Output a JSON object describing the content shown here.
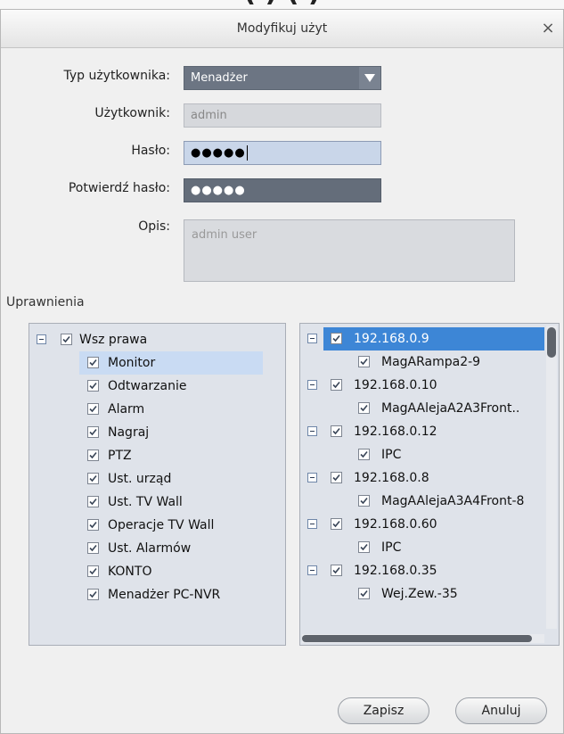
{
  "dialog": {
    "title": "Modyfikuj użyt",
    "close_symbol": "×",
    "form": {
      "user_type": {
        "label": "Typ użytkownika:",
        "value": "Menadżer"
      },
      "username": {
        "label": "Użytkownik:",
        "value": "admin"
      },
      "password": {
        "label": "Hasło:",
        "value": "●●●●●"
      },
      "confirm_password": {
        "label": "Potwierdź hasło:",
        "value": "●●●●●"
      },
      "description": {
        "label": "Opis:",
        "value": "admin user"
      }
    },
    "permissions_section_label": "Uprawnienia",
    "permissions": {
      "root": "Wsz prawa",
      "items": [
        "Monitor",
        "Odtwarzanie",
        "Alarm",
        "Nagraj",
        "PTZ",
        "Ust. urząd",
        "Ust. TV Wall",
        "Operacje TV Wall",
        "Ust. Alarmów",
        "KONTO",
        "Menadżer PC-NVR"
      ]
    },
    "devices": [
      {
        "ip": "192.168.0.9",
        "channel": "MagARampa2-9"
      },
      {
        "ip": "192.168.0.10",
        "channel": "MagAAlejaA2A3Front.."
      },
      {
        "ip": "192.168.0.12",
        "channel": "IPC"
      },
      {
        "ip": "192.168.0.8",
        "channel": "MagAAlejaA3A4Front-8"
      },
      {
        "ip": "192.168.0.60",
        "channel": "IPC"
      },
      {
        "ip": "192.168.0.35",
        "channel": "Wej.Zew.-35"
      }
    ],
    "buttons": {
      "save": "Zapisz",
      "cancel": "Anuluj"
    }
  },
  "icons": [
    "close-icon",
    "dropdown-arrow-icon",
    "collapse-icon",
    "checkbox-checked-icon"
  ],
  "colors": {
    "selection": "#3d86d6",
    "dropdown": "#6c7583",
    "panel": "#dfe3ea"
  }
}
